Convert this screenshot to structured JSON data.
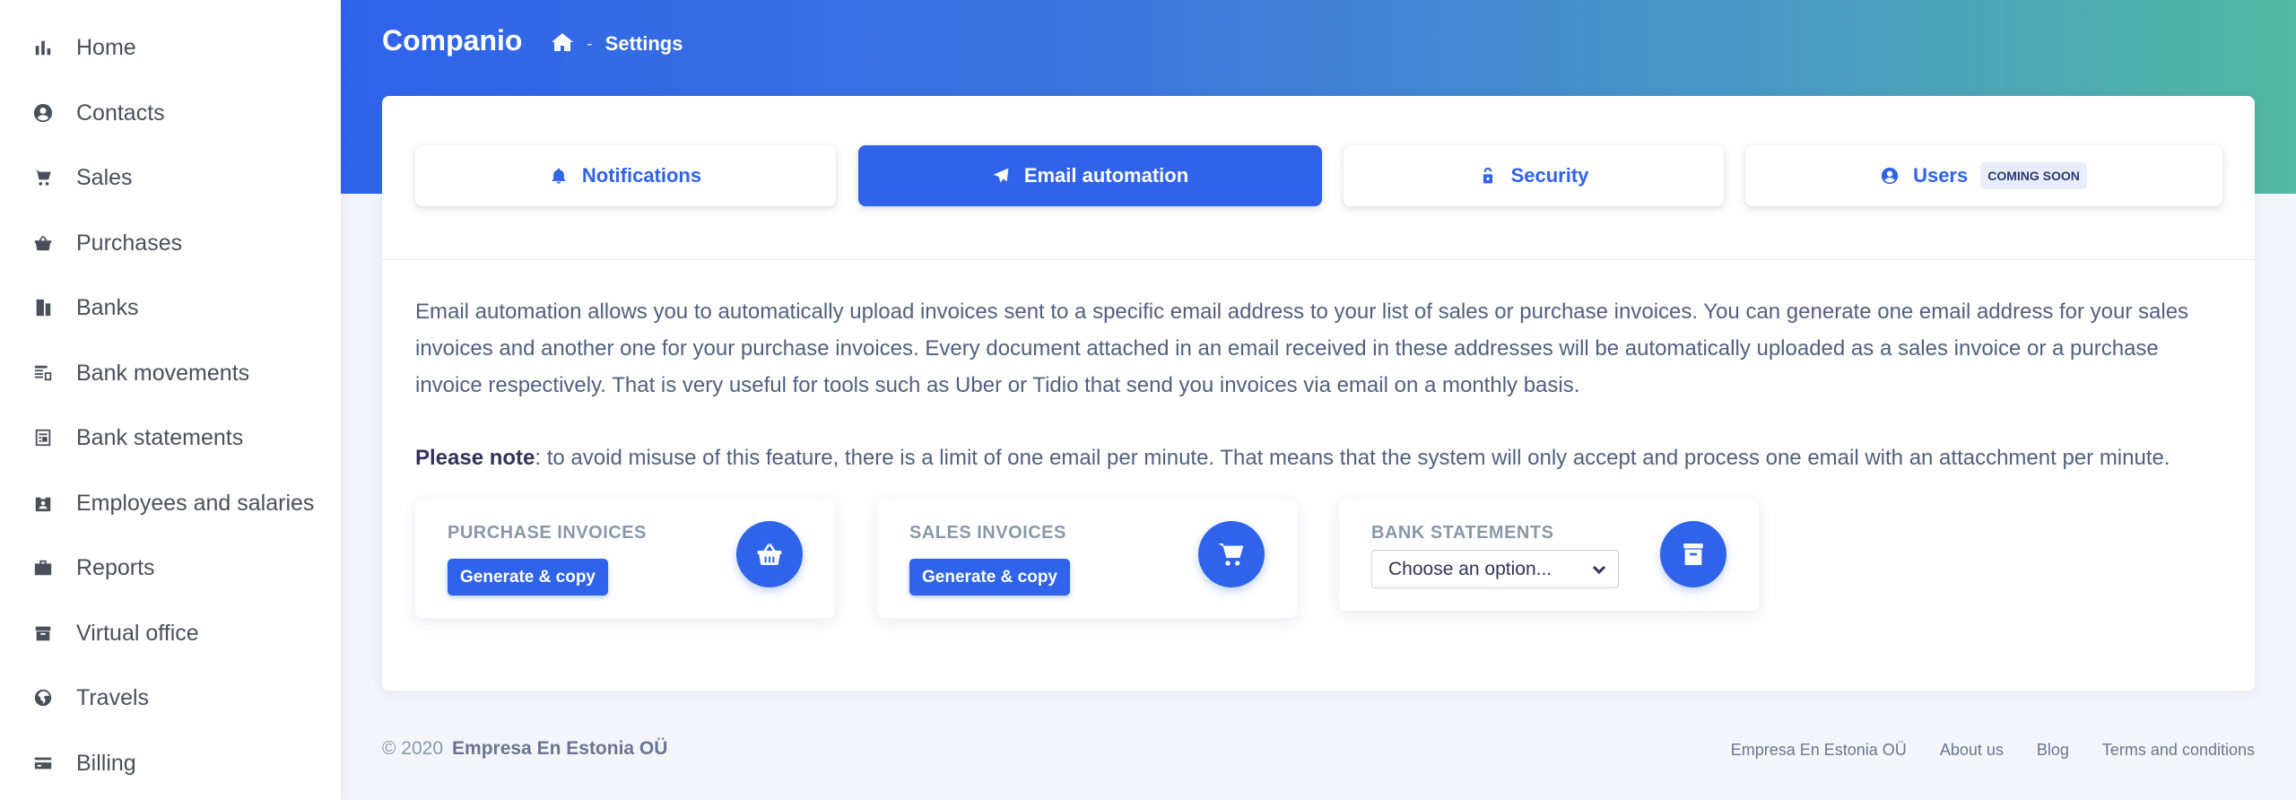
{
  "app": {
    "brand": "Companio"
  },
  "breadcrumb": {
    "current": "Settings"
  },
  "sidebar": {
    "items": [
      {
        "label": "Home",
        "icon": "bar-chart-icon"
      },
      {
        "label": "Contacts",
        "icon": "user-circle-icon"
      },
      {
        "label": "Sales",
        "icon": "cart-icon"
      },
      {
        "label": "Purchases",
        "icon": "basket-icon"
      },
      {
        "label": "Banks",
        "icon": "building-icon"
      },
      {
        "label": "Bank movements",
        "icon": "money-transfer-icon"
      },
      {
        "label": "Bank statements",
        "icon": "document-list-icon"
      },
      {
        "label": "Employees and salaries",
        "icon": "id-badge-icon"
      },
      {
        "label": "Reports",
        "icon": "briefcase-icon"
      },
      {
        "label": "Virtual office",
        "icon": "package-icon"
      },
      {
        "label": "Travels",
        "icon": "globe-icon"
      },
      {
        "label": "Billing",
        "icon": "credit-card-icon"
      }
    ]
  },
  "tabs": [
    {
      "label": "Notifications",
      "icon": "bell-icon",
      "active": false
    },
    {
      "label": "Email automation",
      "icon": "paper-plane-icon",
      "active": true
    },
    {
      "label": "Security",
      "icon": "lock-open-icon",
      "active": false
    },
    {
      "label": "Users",
      "icon": "user-circle-icon",
      "active": false,
      "badge": "COMING SOON"
    }
  ],
  "content": {
    "description": "Email automation allows you to automatically upload invoices sent to a specific email address to your list of sales or purchase invoices. You can generate one email address for your sales invoices and another one for your purchase invoices. Every document attached in an email received in these addresses will be automatically uploaded as a sales invoice or a purchase invoice respectively. That is very useful for tools such as Uber or Tidio that send you invoices via email on a monthly basis.",
    "note_label": "Please note",
    "note_text": ": to avoid misuse of this feature, there is a limit of one email per minute. That means that the system will only accept and process one email with an attacchment per minute."
  },
  "cards": {
    "purchase": {
      "title": "PURCHASE INVOICES",
      "button": "Generate & copy",
      "icon": "basket-icon"
    },
    "sales": {
      "title": "SALES INVOICES",
      "button": "Generate & copy",
      "icon": "cart-icon"
    },
    "bank": {
      "title": "BANK STATEMENTS",
      "select_value": "Choose an option...",
      "icon": "archive-icon"
    }
  },
  "footer": {
    "copyright": "© 2020",
    "company": "Empresa En Estonia OÜ",
    "links": [
      "Empresa En Estonia OÜ",
      "About us",
      "Blog",
      "Terms and conditions"
    ]
  },
  "colors": {
    "accent": "#2f63ea",
    "gradient_end": "#52b9a3"
  }
}
